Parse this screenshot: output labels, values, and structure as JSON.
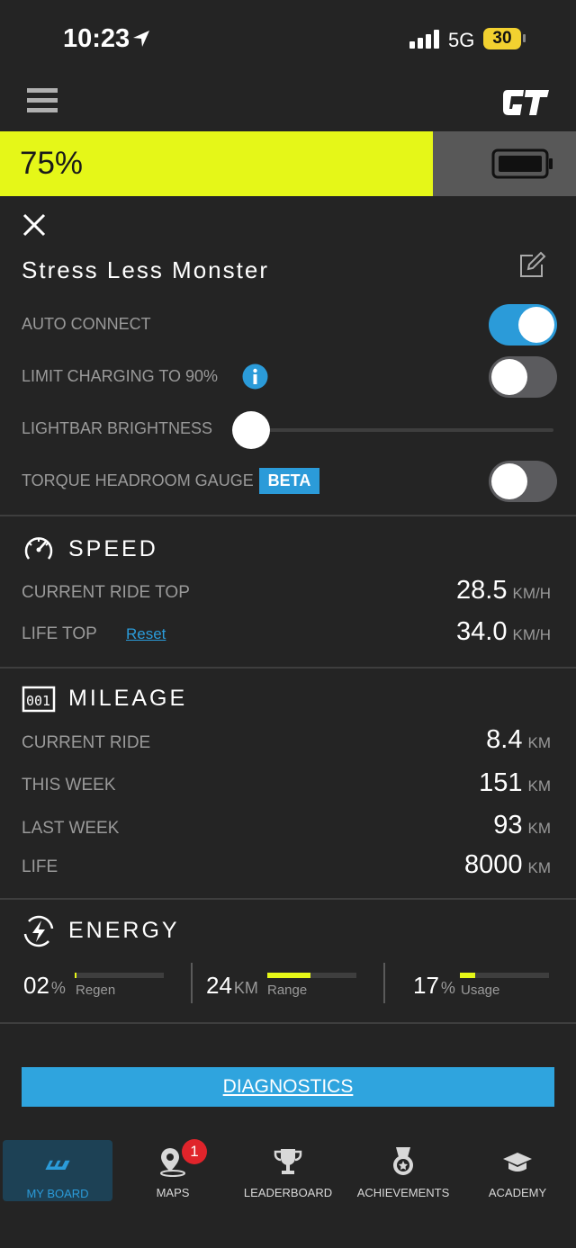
{
  "status_bar": {
    "time": "10:23",
    "network": "5G",
    "battery": "30"
  },
  "battery": {
    "percent_label": "75%",
    "level": 0.75,
    "fill_color": "#e5f718"
  },
  "board": {
    "name": "Stress Less Monster"
  },
  "settings": [
    {
      "label": "AUTO CONNECT",
      "type": "toggle",
      "on": true
    },
    {
      "label": "LIMIT CHARGING TO 90%",
      "type": "toggle",
      "on": false
    },
    {
      "label": "LIGHTBAR BRIGHTNESS",
      "type": "slider",
      "value": 0
    },
    {
      "label": "TORQUE HEADROOM GAUGE",
      "type": "toggle",
      "on": false,
      "badge": "BETA"
    }
  ],
  "speed": {
    "title": "SPEED",
    "rows": [
      {
        "label": "CURRENT RIDE TOP",
        "value": "28.5",
        "unit": "KM/H"
      },
      {
        "label": "LIFE TOP",
        "value": "34.0",
        "unit": "KM/H",
        "link": "Reset"
      }
    ]
  },
  "mileage": {
    "title": "MILEAGE",
    "rows": [
      {
        "label": "CURRENT RIDE",
        "value": "8.4",
        "unit": "KM"
      },
      {
        "label": "THIS WEEK",
        "value": "151",
        "unit": "KM"
      },
      {
        "label": "LAST WEEK",
        "value": "93",
        "unit": "KM"
      },
      {
        "label": "LIFE",
        "value": "8000",
        "unit": "KM"
      }
    ]
  },
  "energy": {
    "title": "ENERGY",
    "items": [
      {
        "value": "02",
        "unit": "%",
        "label": "Regen",
        "level": 0.02
      },
      {
        "value": "24",
        "unit": "KM",
        "label": "Range",
        "level": 0.48
      },
      {
        "value": "17",
        "unit": "%",
        "label": "Usage",
        "level": 0.17
      }
    ]
  },
  "diagnostics_label": "DIAGNOSTICS",
  "tabs": [
    {
      "label": "MY BOARD",
      "icon": "board-icon",
      "active": true
    },
    {
      "label": "MAPS",
      "icon": "map-pin-icon",
      "badge": "1"
    },
    {
      "label": "LEADERBOARD",
      "icon": "trophy-icon"
    },
    {
      "label": "ACHIEVEMENTS",
      "icon": "medal-icon"
    },
    {
      "label": "ACADEMY",
      "icon": "graduation-cap-icon"
    }
  ],
  "colors": {
    "accent_blue": "#2b9bd9",
    "accent_yellow": "#e5f718",
    "background": "#242424"
  }
}
